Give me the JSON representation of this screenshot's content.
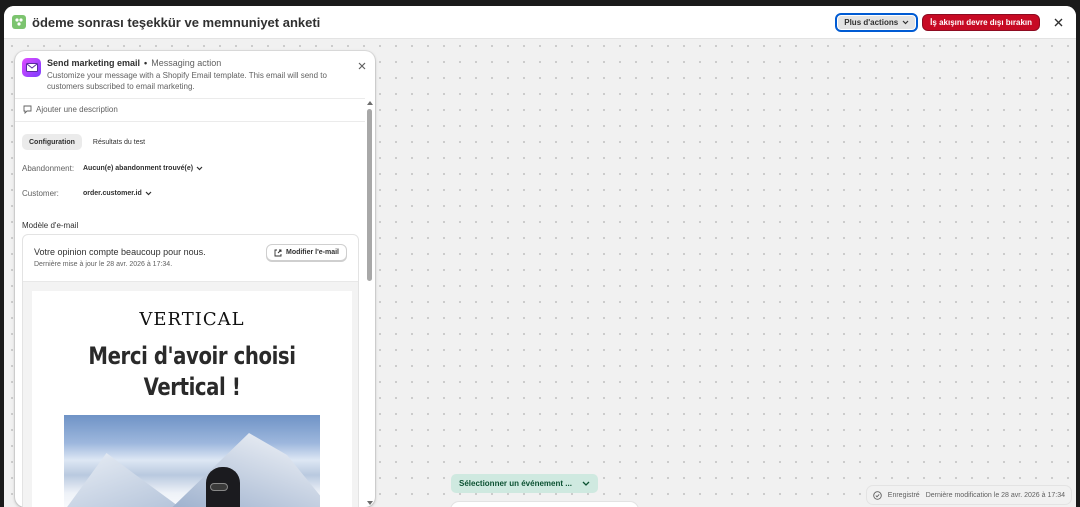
{
  "header": {
    "title": "ödeme sonrası teşekkür ve memnuniyet anketi",
    "more_actions_label": "Plus d'actions",
    "disable_label": "İş akışını devre dışı bırakın"
  },
  "panel": {
    "title": "Send marketing email",
    "subtitle": "Messaging action",
    "description": "Customize your message with a Shopify Email template. This email will send to customers subscribed to email marketing.",
    "add_description_label": "Ajouter une description",
    "tabs": [
      {
        "label": "Configuration",
        "active": true
      },
      {
        "label": "Résultats du test",
        "active": false
      }
    ],
    "fields": {
      "abandonment_label": "Abandonment:",
      "abandonment_value": "Aucun(e) abandonment trouvé(e)",
      "customer_label": "Customer:",
      "customer_value": "order.customer.id"
    },
    "email_template": {
      "section_label": "Modèle d'e-mail",
      "subject": "Votre opinion compte beaucoup pour nous.",
      "updated": "Dernière mise à jour le 28 avr. 2026 à 17:34.",
      "edit_label": "Modifier l'e-mail",
      "preview": {
        "brand": "VERTICAL",
        "headline_line1": "Merci d'avoir choisi",
        "headline_line2": "Vertical !"
      }
    }
  },
  "canvas": {
    "event_select_label": "Sélectionner un événement ..."
  },
  "status": {
    "saved_label": "Enregistré",
    "last_modified": "Dernière modification le 28 avr. 2026 à 17:34"
  },
  "colors": {
    "accent": "#005bd3",
    "critical": "#c70a24",
    "event_bg": "#cfe9e0"
  }
}
